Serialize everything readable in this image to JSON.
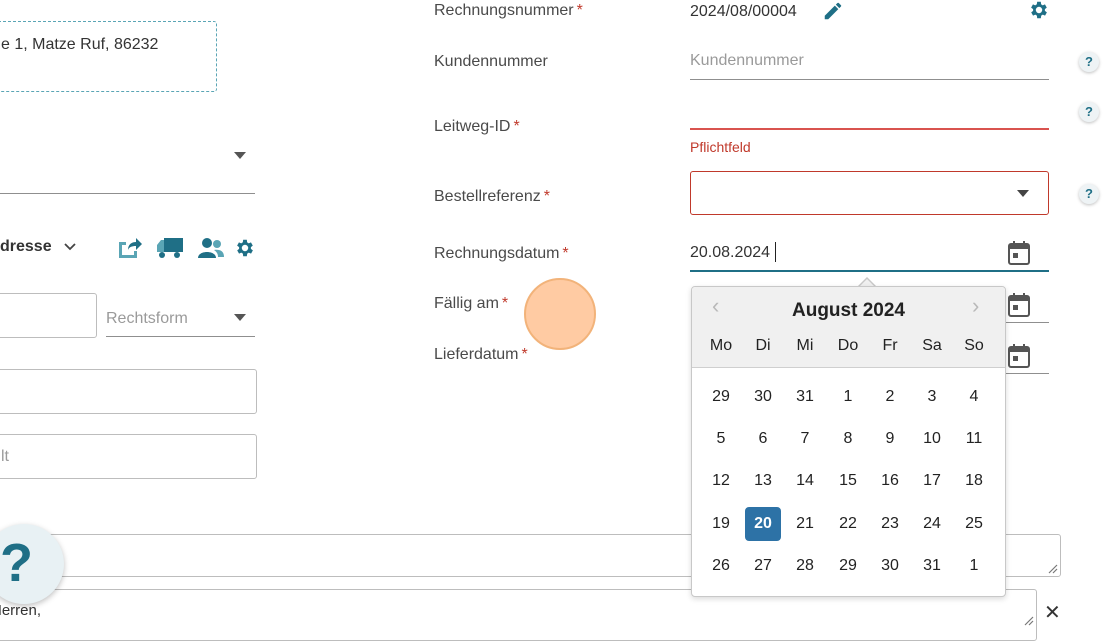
{
  "left": {
    "address_value": "e 1, Matze Ruf, 86232",
    "address_dropdown_label": "dresse",
    "rechtsform_placeholder": "Rechtsform",
    "field3_placeholder": "lt",
    "textarea_text": "Herren,"
  },
  "form": {
    "rechnungsnummer_label": "Rechnungsnummer",
    "rechnungsnummer_value": "2024/08/00004",
    "kundennummer_label": "Kundennummer",
    "kundennummer_placeholder": "Kundennummer",
    "leitweg_label": "Leitweg-ID",
    "leitweg_error": "Pflichtfeld",
    "bestellreferenz_label": "Bestellreferenz",
    "rechnungsdatum_label": "Rechnungsdatum",
    "rechnungsdatum_value": "20.08.2024",
    "faellig_label": "Fällig am",
    "lieferdatum_label": "Lieferdatum",
    "required_mark": "*",
    "help_mark": "?"
  },
  "calendar": {
    "title": "August 2024",
    "prev": "‹",
    "next": "›",
    "weekdays": [
      "Mo",
      "Di",
      "Mi",
      "Do",
      "Fr",
      "Sa",
      "So"
    ],
    "weeks": [
      [
        "29",
        "30",
        "31",
        "1",
        "2",
        "3",
        "4"
      ],
      [
        "5",
        "6",
        "7",
        "8",
        "9",
        "10",
        "11"
      ],
      [
        "12",
        "13",
        "14",
        "15",
        "16",
        "17",
        "18"
      ],
      [
        "19",
        "20",
        "21",
        "22",
        "23",
        "24",
        "25"
      ],
      [
        "26",
        "27",
        "28",
        "29",
        "30",
        "31",
        "1"
      ]
    ],
    "selected_day": "20"
  },
  "help_fab_label": "?",
  "close_label": "✕",
  "colors": {
    "accent": "#1f6f86",
    "error": "#c0392b",
    "selected": "#2d72a6"
  }
}
